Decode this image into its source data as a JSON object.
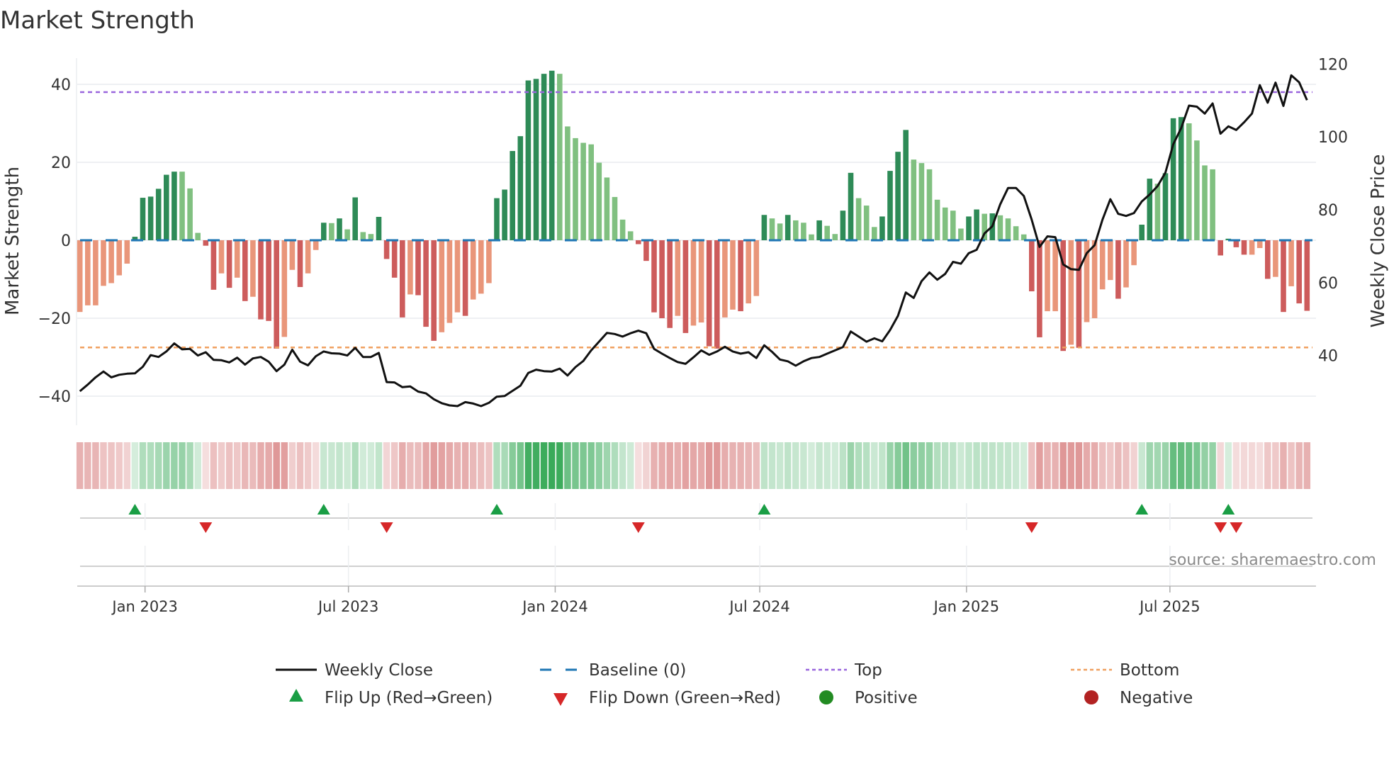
{
  "title": "Market Strength",
  "source": "source: sharemaestro.com",
  "colors": {
    "pos_rising": "#2e8b57",
    "pos_falling": "#80c080",
    "neg_falling": "#cd5c5c",
    "neg_rising": "#e9967a",
    "price_line": "#111111",
    "baseline": "#1f77b4",
    "top": "#9966dd",
    "bottom": "#f0a060",
    "flip_up": "#1a9e45",
    "flip_down": "#d62728",
    "positive": "#228b22",
    "negative": "#b22222",
    "strip_green": "34,160,70",
    "strip_red": "205,92,92"
  },
  "legend": [
    {
      "key": "weekly_close",
      "label": "Weekly Close"
    },
    {
      "key": "baseline",
      "label": "Baseline (0)"
    },
    {
      "key": "top",
      "label": "Top"
    },
    {
      "key": "bottom",
      "label": "Bottom"
    },
    {
      "key": "flip_up",
      "label": "Flip Up (Red→Green)"
    },
    {
      "key": "flip_down",
      "label": "Flip Down (Green→Red)"
    },
    {
      "key": "positive",
      "label": "Positive"
    },
    {
      "key": "negative",
      "label": "Negative"
    }
  ],
  "chart_data": {
    "type": "bar",
    "title": "Market Strength",
    "ylabel": "Market Strength",
    "y2label": "Weekly Close Price",
    "ylim": [
      -47.5,
      46.7
    ],
    "y2lim": [
      20.9,
      121.6
    ],
    "yticks": [
      {
        "v": 40,
        "label": "40"
      },
      {
        "v": 20,
        "label": "20"
      },
      {
        "v": 0,
        "label": "0"
      },
      {
        "v": -20,
        "label": "−20"
      },
      {
        "v": -40,
        "label": "−40"
      }
    ],
    "y2ticks": [
      {
        "v": 120,
        "label": "120"
      },
      {
        "v": 100,
        "label": "100"
      },
      {
        "v": 80,
        "label": "80"
      },
      {
        "v": 60,
        "label": "60"
      },
      {
        "v": 40,
        "label": "40"
      }
    ],
    "xticks": [
      {
        "date": "2023-01-01",
        "label": "Jan 2023"
      },
      {
        "date": "2023-07-01",
        "label": "Jul 2023"
      },
      {
        "date": "2024-01-01",
        "label": "Jan 2024"
      },
      {
        "date": "2024-07-01",
        "label": "Jul 2024"
      },
      {
        "date": "2025-01-01",
        "label": "Jan 2025"
      },
      {
        "date": "2025-07-01",
        "label": "Jul 2025"
      }
    ],
    "start_date": "2022-11-04",
    "frequency": "weekly",
    "top_level": 38,
    "bottom_level": -27.5,
    "baseline": 0,
    "strength": [
      -18.4,
      -16.7,
      -16.7,
      -11.7,
      -11,
      -9,
      -6,
      0.9,
      10.9,
      11.2,
      13.2,
      16.8,
      17.6,
      17.6,
      13.3,
      1.9,
      -1.4,
      -12.7,
      -8.5,
      -12.2,
      -9.6,
      -15.6,
      -14.5,
      -20.3,
      -20.7,
      -27.8,
      -24.8,
      -7.6,
      -12,
      -8.5,
      -2.5,
      4.5,
      4.4,
      5.6,
      2.8,
      11,
      2.1,
      1.6,
      6,
      -4.8,
      -9.6,
      -19.8,
      -13.9,
      -14.1,
      -22.2,
      -25.8,
      -23.6,
      -21.2,
      -18.5,
      -19.4,
      -15.2,
      -13.7,
      -11,
      10.8,
      13,
      22.9,
      26.7,
      41,
      41.4,
      42.7,
      43.5,
      42.7,
      29.2,
      26.2,
      25,
      24.6,
      19.9,
      16.1,
      11.1,
      5.3,
      2.3,
      -1,
      -5.3,
      -18.5,
      -20,
      -22.5,
      -19.4,
      -23.8,
      -21.9,
      -21.1,
      -27.2,
      -27.8,
      -19.8,
      -17.8,
      -18.2,
      -16.2,
      -14.3,
      6.5,
      5.6,
      4.3,
      6.5,
      5.1,
      4.5,
      1.5,
      5.1,
      3.7,
      1.6,
      7.6,
      17.3,
      10.8,
      8.9,
      3.4,
      6.1,
      17.8,
      22.7,
      28.3,
      20.7,
      19.8,
      18.2,
      10.4,
      8.4,
      7.6,
      3,
      6.1,
      7.9,
      6.8,
      6.9,
      6.4,
      5.6,
      3.6,
      1.5,
      -13.1,
      -24.9,
      -18.2,
      -18.2,
      -28.4,
      -26.8,
      -27.6,
      -21,
      -20,
      -12.6,
      -10.2,
      -15,
      -12.1,
      -6.4,
      4,
      15.8,
      14.5,
      17.2,
      31.3,
      31.6,
      30,
      25.6,
      19.2,
      18.2,
      -3.9,
      0.4,
      -1.8,
      -3.7,
      -3.7,
      -2,
      -9.9,
      -9.4,
      -18.4,
      -11.8,
      -16.2,
      -18.1
    ],
    "weekly_close": [
      30.2,
      32.0,
      34.0,
      35.6,
      34.0,
      34.7,
      35.0,
      35.1,
      36.9,
      40.1,
      39.6,
      41.1,
      43.3,
      41.7,
      41.8,
      40.0,
      40.9,
      38.8,
      38.7,
      38.1,
      39.4,
      37.5,
      39.2,
      39.6,
      38.3,
      35.7,
      37.5,
      41.6,
      38.3,
      37.3,
      39.8,
      41.1,
      40.6,
      40.5,
      40.0,
      42.1,
      39.6,
      39.6,
      40.7,
      32.7,
      32.6,
      31.3,
      31.5,
      30.1,
      29.6,
      28.0,
      26.9,
      26.3,
      26.1,
      27.2,
      26.8,
      26.1,
      27.0,
      28.7,
      28.9,
      30.3,
      31.7,
      35.2,
      36.1,
      35.7,
      35.6,
      36.4,
      34.5,
      36.8,
      38.5,
      41.4,
      43.8,
      46.2,
      45.9,
      45.2,
      46.1,
      46.8,
      46.1,
      41.8,
      40.5,
      39.3,
      38.2,
      37.7,
      39.5,
      41.4,
      40.2,
      41.1,
      42.4,
      41.1,
      40.5,
      40.9,
      39.3,
      42.8,
      41.0,
      38.9,
      38.4,
      37.2,
      38.4,
      39.3,
      39.6,
      40.5,
      41.4,
      42.3,
      46.6,
      45.2,
      43.8,
      44.7,
      43.9,
      47.0,
      50.9,
      57.3,
      55.8,
      60.4,
      62.8,
      60.8,
      62.4,
      65.7,
      65.2,
      68.1,
      69.0,
      73.5,
      75.5,
      81.5,
      86.0,
      86.0,
      83.8,
      77.3,
      69.8,
      72.7,
      72.5,
      65.0,
      63.7,
      63.5,
      68.1,
      70.3,
      77.3,
      82.9,
      78.9,
      78.3,
      79.1,
      82.3,
      84.2,
      86.5,
      90.2,
      98.0,
      102.4,
      108.6,
      108.3,
      106.4,
      109.2,
      100.9,
      102.9,
      101.9,
      104.0,
      106.4,
      114.2,
      109.4,
      114.9,
      108.5,
      116.9,
      115.0,
      110.1
    ],
    "grid": true,
    "legend_position": "bottom-center"
  }
}
